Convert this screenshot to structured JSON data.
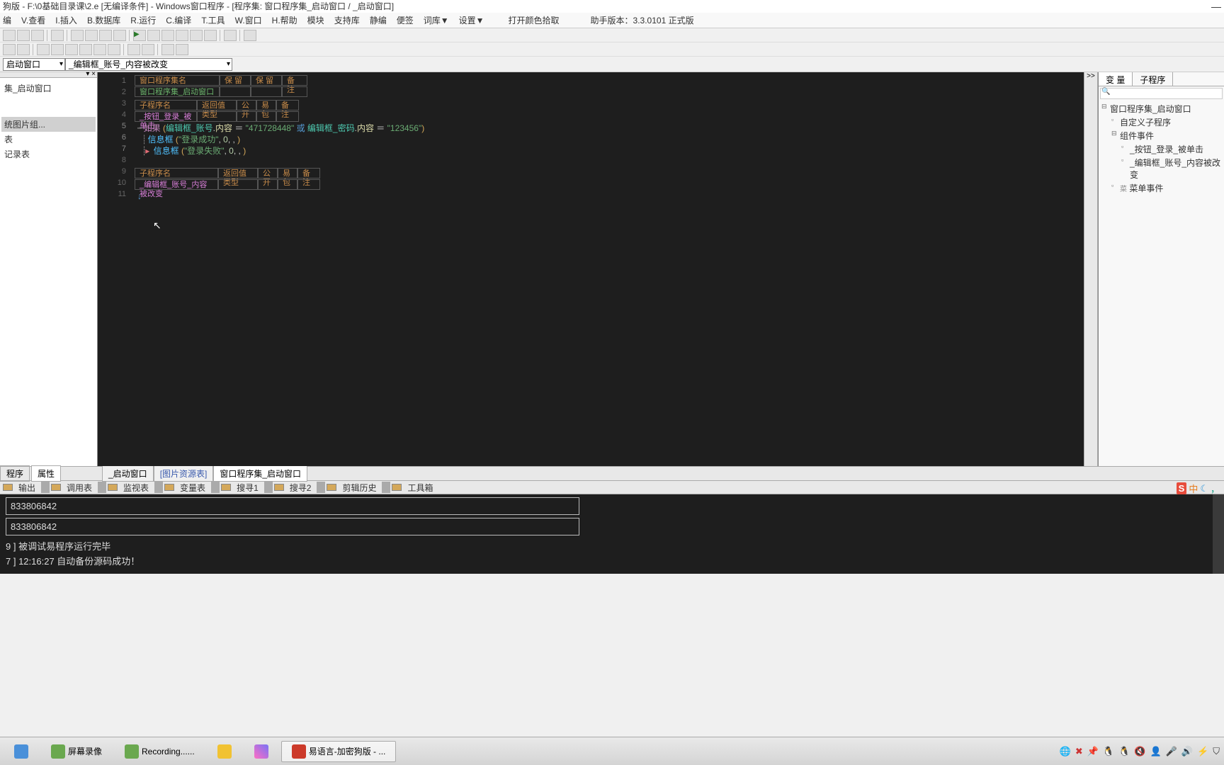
{
  "title_bar": {
    "text": "狗版 - F:\\0基础目录课\\2.e [无编译条件] - Windows窗口程序 - [程序集: 窗口程序集_启动窗口 / _启动窗口]",
    "minimize": "—"
  },
  "menu": {
    "items": [
      "编",
      "V.查看",
      "I.插入",
      "B.数据库",
      "R.运行",
      "C.编译",
      "T.工具",
      "W.窗口",
      "H.帮助",
      "模块",
      "支持库",
      "静编",
      "便签",
      "词库▼",
      "设置▼",
      "打开颜色拾取"
    ],
    "info": "助手版本：3.3.0101 正式版"
  },
  "dropdowns": {
    "left": "启动窗口",
    "right": "_编辑框_账号_内容被改变"
  },
  "left_panel": {
    "items": [
      "集_启动窗口",
      "",
      "",
      "统图片组...",
      "表",
      "记录表"
    ]
  },
  "line_numbers": [
    "1",
    "2",
    "3",
    "4",
    "5",
    "6",
    "7",
    "8",
    "9",
    "10",
    "11"
  ],
  "code": {
    "table1": {
      "headers": [
        "窗口程序集名",
        "保 留",
        "保 留",
        "备 注"
      ],
      "row": "窗口程序集_启动窗口"
    },
    "table2": {
      "headers": [
        "子程序名",
        "返回值类型",
        "公开",
        "易包",
        "备 注"
      ],
      "row": "_按钮_登录_被单击"
    },
    "line5": {
      "dots": "┉",
      "kw": "如果",
      "p1": "(",
      "var1": "编辑框_账号",
      "dot1": ".",
      "prop1": "内容",
      "eq1": " ＝ ",
      "str1": "\"471728448\"",
      "or": " 或 ",
      "var2": "编辑框_密码",
      "dot2": ".",
      "prop2": "内容",
      "eq2": " ＝ ",
      "str2": "\"123456\"",
      "p2": ")"
    },
    "line6": {
      "dots": "┊",
      "fn": "信息框",
      "p1": " (",
      "str": "\"登录成功\"",
      "c1": ", ",
      "n": "0",
      "c2": ", ",
      "c3": ", ",
      "p2": ")"
    },
    "line7": {
      "dots": "┊",
      "arrow": "▸",
      "fn": "信息框",
      "p1": " (",
      "str": "\"登录失败\"",
      "c1": ", ",
      "n": "0",
      "c2": ", ",
      "c3": ", ",
      "p2": ")"
    },
    "table3": {
      "headers": [
        "子程序名",
        "返回值类型",
        "公开",
        "易包",
        "备 注"
      ],
      "row": "_编辑框_账号_内容被改变"
    },
    "line11_arrow": "↓"
  },
  "right_panel": {
    "arrow": ">>",
    "tabs": [
      "变 量",
      "子程序"
    ],
    "search_placeholder": "",
    "tree": [
      {
        "level": 1,
        "text": "窗口程序集_启动窗口",
        "leaf": false
      },
      {
        "level": 2,
        "text": "自定义子程序",
        "leaf": true
      },
      {
        "level": 2,
        "text": "组件事件",
        "leaf": false
      },
      {
        "level": 3,
        "text": "_按钮_登录_被单击",
        "leaf": true
      },
      {
        "level": 3,
        "text": "_编辑框_账号_内容被改变",
        "leaf": true
      },
      {
        "level": 2,
        "text": "菜单事件",
        "leaf": true,
        "prefix": "菜"
      }
    ]
  },
  "prop_tabs": [
    "程序",
    "属性"
  ],
  "file_tabs": [
    "_启动窗口",
    "[图片资源表]",
    "窗口程序集_启动窗口"
  ],
  "tool_tabs": [
    "输出",
    "调用表",
    "监视表",
    "变量表",
    "搜寻1",
    "搜寻2",
    "剪辑历史",
    "工具箱"
  ],
  "output": {
    "box1": "833806842",
    "box2": "833806842",
    "log1": "9 ]  被调试易程序运行完毕",
    "log2": "7 ]  12:16:27 自动备份源码成功！"
  },
  "right_icons": {
    "s": "S",
    "cn": "中",
    "moon": "☾",
    "comma": "，"
  },
  "taskbar": {
    "items": [
      "",
      "屏幕录像",
      "Recording......",
      "",
      "",
      "易语言-加密狗版 - ..."
    ],
    "tray_icons": [
      "🌐",
      "✖",
      "📌",
      "🐧",
      "🐧",
      "🔇",
      "👤",
      "🎤",
      "🔊",
      "⚡",
      "⛉"
    ]
  }
}
